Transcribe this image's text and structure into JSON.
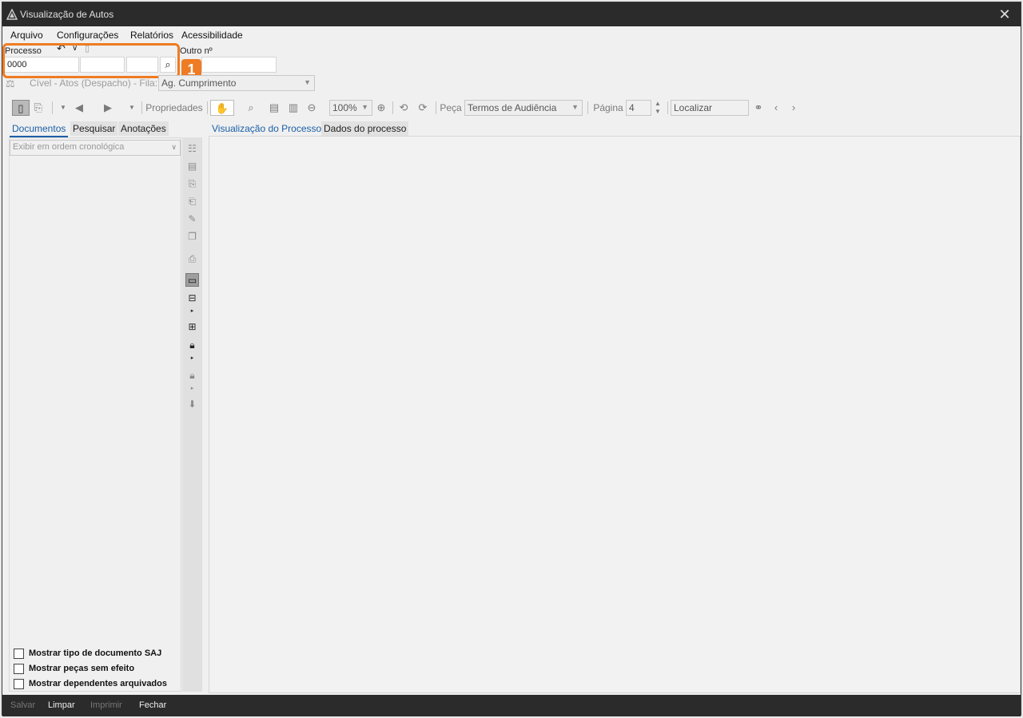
{
  "window": {
    "title": "Visualização de Autos",
    "close_icon": "close-icon"
  },
  "menu": [
    {
      "label": "Arquivo"
    },
    {
      "label": "Configurações"
    },
    {
      "label": "Relatórios"
    },
    {
      "label": "Acessibilidade"
    }
  ],
  "processo": {
    "label": "Processo",
    "value": "0000",
    "outro_label": "Outro nº",
    "outro_value": ""
  },
  "callout": {
    "number": "1",
    "accent": "#ef7b22"
  },
  "queue": {
    "text": "Cível - Atos (Despacho) - Fila:",
    "selected": "Ag. Cumprimento"
  },
  "toolbar": {
    "properties_label": "Propriedades",
    "zoom_value": "100%",
    "peca_label": "Peça",
    "peca_selected": "Termos de Audiência",
    "pagina_label": "Página",
    "pagina_value": "4",
    "search_placeholder": "Localizar"
  },
  "left_tabs": [
    {
      "label": "Documentos"
    },
    {
      "label": "Pesquisar"
    },
    {
      "label": "Anotações"
    }
  ],
  "order_select": {
    "selected": "Exibir em ordem cronológica"
  },
  "checkboxes": [
    {
      "label": "Mostrar tipo de documento SAJ"
    },
    {
      "label": "Mostrar peças sem efeito"
    },
    {
      "label": "Mostrar dependentes arquivados"
    }
  ],
  "viewer_tabs": [
    {
      "label": "Visualização do Processo"
    },
    {
      "label": "Dados do processo"
    }
  ],
  "status_buttons": [
    {
      "label": "Salvar"
    },
    {
      "label": "Limpar"
    },
    {
      "label": "Imprimir"
    },
    {
      "label": "Fechar"
    }
  ]
}
